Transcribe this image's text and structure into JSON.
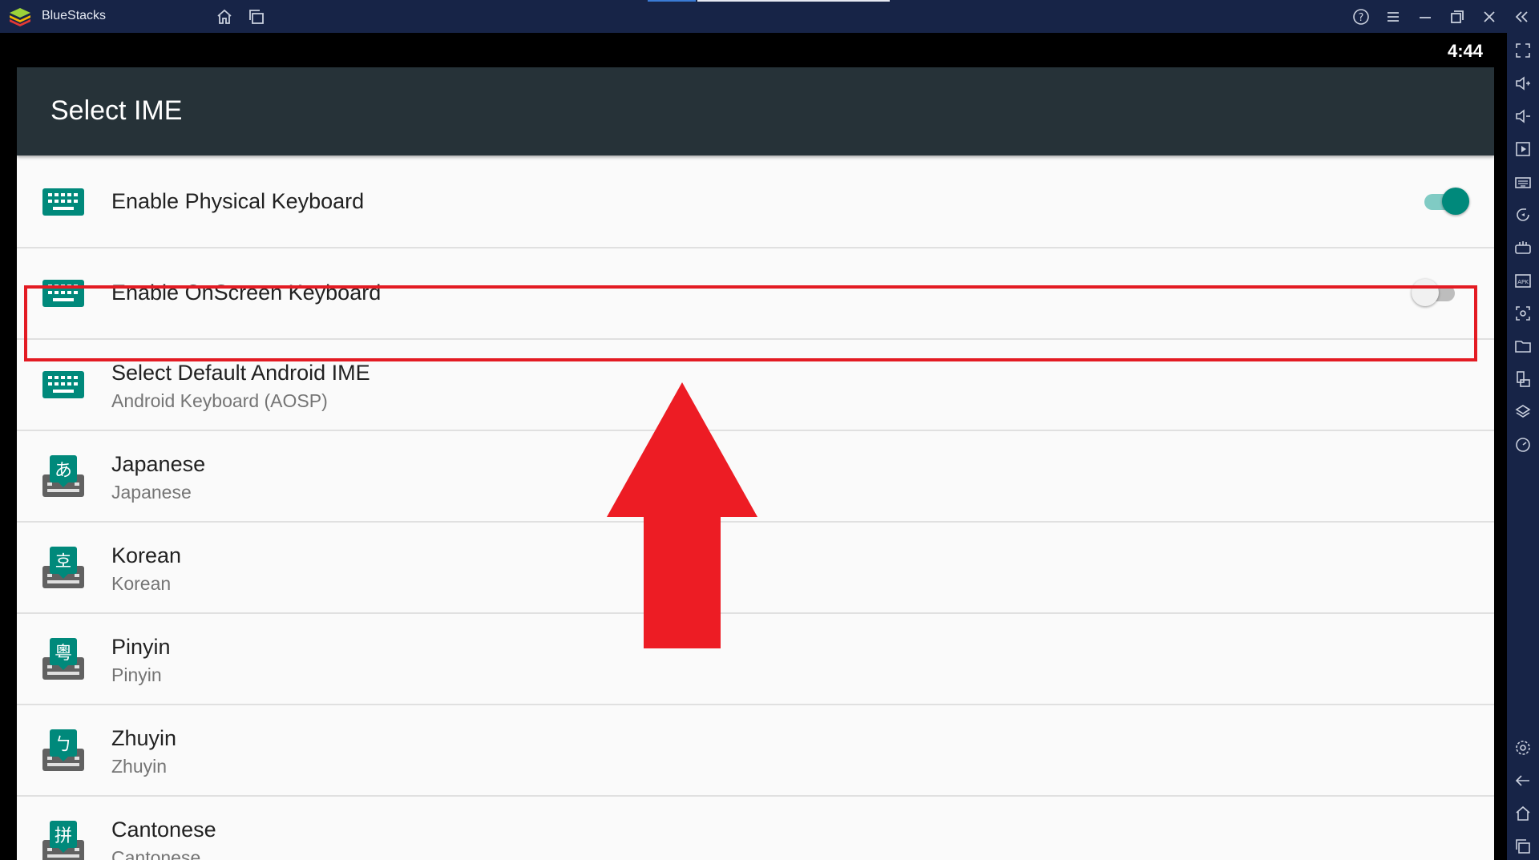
{
  "window": {
    "app_title": "BlueStacks",
    "title_icons": [
      "home-icon",
      "multi-instance-icon"
    ],
    "controls": [
      "help-icon",
      "menu-icon",
      "minimize-icon",
      "restore-icon",
      "close-icon",
      "collapse-sidebar-icon"
    ]
  },
  "status_bar": {
    "clock": "4:44"
  },
  "app_bar": {
    "title": "Select IME"
  },
  "settings": [
    {
      "label": "Enable Physical Keyboard",
      "icon": "keyboard-icon",
      "toggle": true
    },
    {
      "label": "Enable OnScreen Keyboard",
      "icon": "keyboard-icon",
      "toggle": false
    },
    {
      "label": "Select Default Android IME",
      "sub": "Android Keyboard (AOSP)",
      "icon": "keyboard-icon"
    },
    {
      "label": "Japanese",
      "sub": "Japanese",
      "icon": "japanese-ime-icon",
      "glyph": "あ"
    },
    {
      "label": "Korean",
      "sub": "Korean",
      "icon": "korean-ime-icon",
      "glyph": "호"
    },
    {
      "label": "Pinyin",
      "sub": "Pinyin",
      "icon": "pinyin-ime-icon",
      "glyph": "粵"
    },
    {
      "label": "Zhuyin",
      "sub": "Zhuyin",
      "icon": "zhuyin-ime-icon",
      "glyph": "ㄅ"
    },
    {
      "label": "Cantonese",
      "sub": "Cantonese",
      "icon": "cantonese-ime-icon",
      "glyph": "拼"
    }
  ],
  "sidebar_icons": [
    "fullscreen-icon",
    "volume-up-icon",
    "volume-down-icon",
    "media-icon",
    "keyboard-icon",
    "rotate-icon",
    "gamepad-icon",
    "apk-icon",
    "screenshot-icon",
    "folder-icon",
    "multi-instance-icon",
    "layers-icon",
    "eco-mode-icon",
    "settings-icon",
    "back-icon",
    "home-icon",
    "recent-apps-icon"
  ],
  "colors": {
    "accent": "#00897b",
    "app_bar": "#263238",
    "title_bar": "#172447",
    "highlight": "#e31b23",
    "arrow": "#ed1c24"
  }
}
